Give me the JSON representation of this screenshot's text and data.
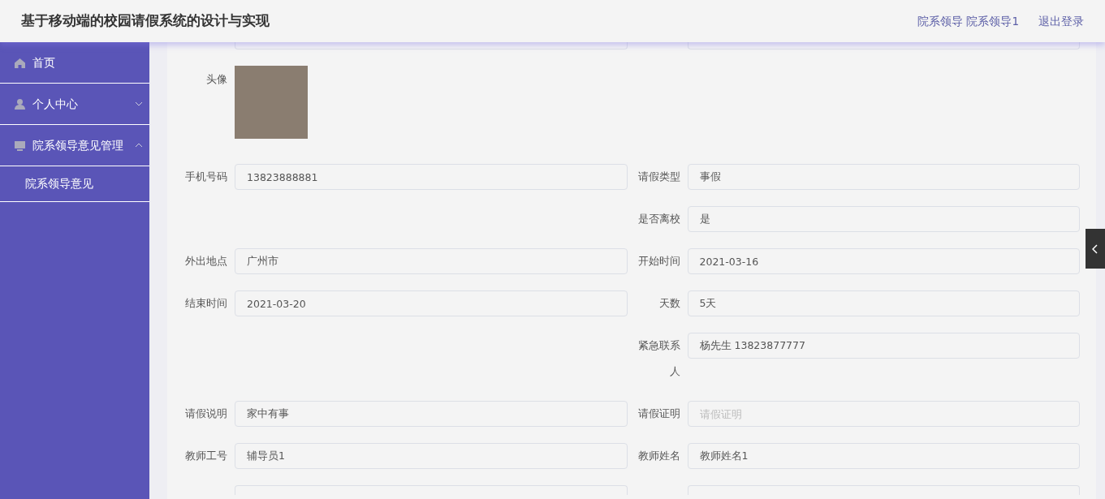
{
  "header": {
    "title": "基于移动端的校园请假系统的设计与实现",
    "user": "院系领导 院系领导1",
    "logout": "退出登录"
  },
  "sidebar": {
    "items": [
      {
        "label": "首页",
        "kind": "home"
      },
      {
        "label": "个人中心",
        "kind": "user",
        "expanded": false
      },
      {
        "label": "院系领导意见管理",
        "kind": "monitor",
        "expanded": true,
        "children": [
          {
            "label": "院系领导意见"
          }
        ]
      }
    ]
  },
  "form": {
    "avatar_label": "头像",
    "rows": [
      {
        "left": {
          "label": "手机号码",
          "value": "13823888881"
        },
        "right": {
          "label": "请假类型",
          "value": "事假"
        }
      },
      {
        "left": null,
        "right": {
          "label": "是否离校",
          "value": "是"
        }
      },
      {
        "left": {
          "label": "外出地点",
          "value": "广州市"
        },
        "right": {
          "label": "开始时间",
          "value": "2021-03-16"
        }
      },
      {
        "left": {
          "label": "结束时间",
          "value": "2021-03-20"
        },
        "right": {
          "label": "天数",
          "value": "5天"
        }
      },
      {
        "left": null,
        "right": {
          "label": "紧急联系人",
          "value": "杨先生 13823877777"
        }
      },
      {
        "left": {
          "label": "请假说明",
          "value": "家中有事"
        },
        "right": {
          "label": "请假证明",
          "placeholder": "请假证明"
        }
      },
      {
        "left": {
          "label": "教师工号",
          "value": "辅导员1"
        },
        "right": {
          "label": "教师姓名",
          "value": "教师姓名1"
        }
      }
    ]
  }
}
